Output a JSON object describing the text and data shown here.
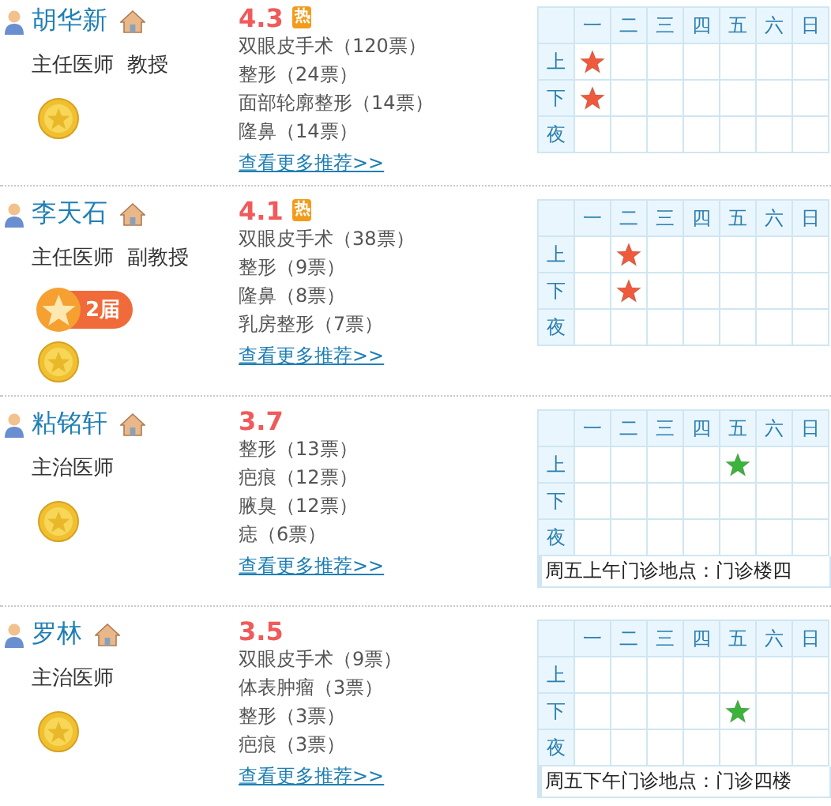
{
  "doctors": [
    {
      "name": "胡华新",
      "title": "主任医师  教授",
      "score": "4.3",
      "hot_label": "热",
      "recommendations": [
        "双眼皮手术（120票）",
        "整形（24票）",
        "面部轮廓整形（14票）",
        "隆鼻（14票）"
      ],
      "more_link": "查看更多推荐>>",
      "schedule": {
        "color": "#f05a3c",
        "days": [
          "一",
          "二",
          "三",
          "四",
          "五",
          "六",
          "日"
        ],
        "rows": [
          {
            "label": "上",
            "cells": [
              {
                "on": true
              },
              {
                "on": false
              },
              {
                "on": false
              },
              {
                "on": false
              },
              {
                "on": false
              },
              {
                "on": false
              },
              {
                "on": false
              }
            ]
          },
          {
            "label": "下",
            "cells": [
              {
                "on": true
              },
              {
                "on": false
              },
              {
                "on": false
              },
              {
                "on": false
              },
              {
                "on": false
              },
              {
                "on": false
              },
              {
                "on": false
              }
            ]
          },
          {
            "label": "夜",
            "cells": [
              {
                "on": false
              },
              {
                "on": false
              },
              {
                "on": false
              },
              {
                "on": false
              },
              {
                "on": false
              },
              {
                "on": false
              },
              {
                "on": false
              }
            ]
          }
        ]
      }
    },
    {
      "name": "李天石",
      "title": "主任医师  副教授",
      "badge": "2届",
      "score": "4.1",
      "hot_label": "热",
      "recommendations": [
        "双眼皮手术（38票）",
        "整形（9票）",
        "隆鼻（8票）",
        "乳房整形（7票）"
      ],
      "more_link": "查看更多推荐>>",
      "schedule": {
        "color": "#f05a3c",
        "days": [
          "一",
          "二",
          "三",
          "四",
          "五",
          "六",
          "日"
        ],
        "rows": [
          {
            "label": "上",
            "cells": [
              {
                "on": false
              },
              {
                "on": true
              },
              {
                "on": false
              },
              {
                "on": false
              },
              {
                "on": false
              },
              {
                "on": false
              },
              {
                "on": false
              }
            ]
          },
          {
            "label": "下",
            "cells": [
              {
                "on": false
              },
              {
                "on": true
              },
              {
                "on": false
              },
              {
                "on": false
              },
              {
                "on": false
              },
              {
                "on": false
              },
              {
                "on": false
              }
            ]
          },
          {
            "label": "夜",
            "cells": [
              {
                "on": false
              },
              {
                "on": false
              },
              {
                "on": false
              },
              {
                "on": false
              },
              {
                "on": false
              },
              {
                "on": false
              },
              {
                "on": false
              }
            ]
          }
        ]
      }
    },
    {
      "name": "粘铭轩",
      "title": "主治医师",
      "score": "3.7",
      "recommendations": [
        "整形（13票）",
        "疤痕（12票）",
        "腋臭（12票）",
        "痣（6票）"
      ],
      "more_link": "查看更多推荐>>",
      "schedule": {
        "color": "#3cb43c",
        "days": [
          "一",
          "二",
          "三",
          "四",
          "五",
          "六",
          "日"
        ],
        "rows": [
          {
            "label": "上",
            "cells": [
              {
                "on": false
              },
              {
                "on": false
              },
              {
                "on": false
              },
              {
                "on": false
              },
              {
                "on": true
              },
              {
                "on": false
              },
              {
                "on": false
              }
            ]
          },
          {
            "label": "下",
            "cells": [
              {
                "on": false
              },
              {
                "on": false
              },
              {
                "on": false
              },
              {
                "on": false
              },
              {
                "on": false
              },
              {
                "on": false
              },
              {
                "on": false
              }
            ]
          },
          {
            "label": "夜",
            "cells": [
              {
                "on": false
              },
              {
                "on": false
              },
              {
                "on": false
              },
              {
                "on": false
              },
              {
                "on": false
              },
              {
                "on": false
              },
              {
                "on": false
              }
            ]
          }
        ],
        "note": "周五上午门诊地点：门诊楼四"
      }
    },
    {
      "name": "罗林",
      "title": "主治医师",
      "score": "3.5",
      "recommendations": [
        "双眼皮手术（9票）",
        "体表肿瘤（3票）",
        "整形（3票）",
        "疤痕（3票）"
      ],
      "more_link": "查看更多推荐>>",
      "schedule": {
        "color": "#3cb43c",
        "days": [
          "一",
          "二",
          "三",
          "四",
          "五",
          "六",
          "日"
        ],
        "rows": [
          {
            "label": "上",
            "cells": [
              {
                "on": false
              },
              {
                "on": false
              },
              {
                "on": false
              },
              {
                "on": false
              },
              {
                "on": false
              },
              {
                "on": false
              },
              {
                "on": false
              }
            ]
          },
          {
            "label": "下",
            "cells": [
              {
                "on": false
              },
              {
                "on": false
              },
              {
                "on": false
              },
              {
                "on": false
              },
              {
                "on": true
              },
              {
                "on": false
              },
              {
                "on": false
              }
            ]
          },
          {
            "label": "夜",
            "cells": [
              {
                "on": false
              },
              {
                "on": false
              },
              {
                "on": false
              },
              {
                "on": false
              },
              {
                "on": false
              },
              {
                "on": false
              },
              {
                "on": false
              }
            ]
          }
        ],
        "note": "周五下午门诊地点：门诊四楼"
      }
    }
  ]
}
